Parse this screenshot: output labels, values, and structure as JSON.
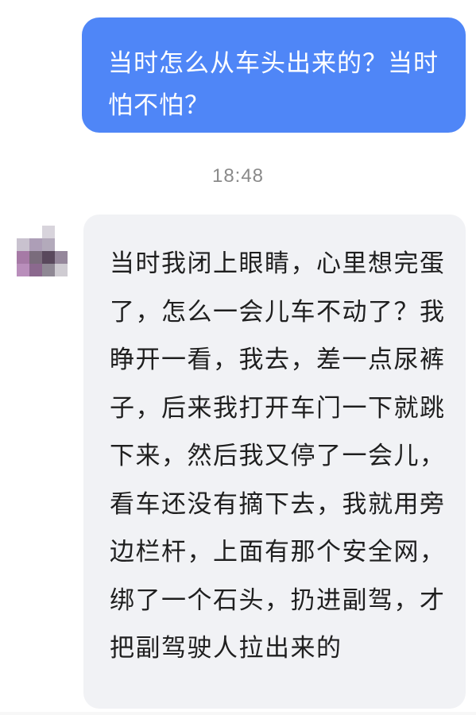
{
  "messages": [
    {
      "direction": "outgoing",
      "text": "当时怎么从车头出来的？当时怕不怕？"
    },
    {
      "direction": "incoming",
      "text": "当时我闭上眼睛，心里想完蛋了，怎么一会儿车不动了？我睁开一看，我去，差一点尿裤子，后来我打开车门一下就跳下来，然后我又停了一会儿，看车还没有摘下去，我就用旁边栏杆，上面有那个安全网，绑了一个石头，扔进副驾，才把副驾驶人拉出来的"
    }
  ],
  "timestamp": "18:48",
  "colors": {
    "outgoing_bubble": "#4f86f7",
    "incoming_bubble": "#f1f2f5"
  }
}
